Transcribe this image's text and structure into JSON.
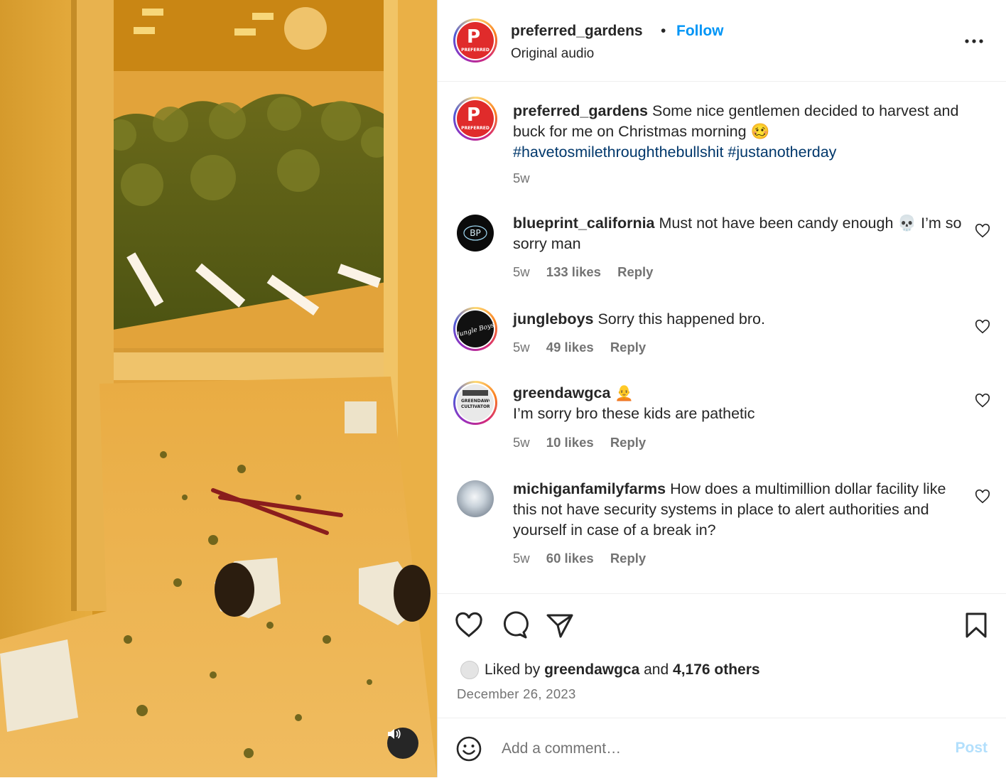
{
  "post": {
    "username": "preferred_gardens",
    "dot": "•",
    "follow_label": "Follow",
    "audio": "Original audio",
    "avatar_text": "PREFERRED"
  },
  "caption": {
    "username": "preferred_gardens",
    "text": "Some nice gentlemen decided to harvest and buck for me on Christmas morning 🥴",
    "hashtags": [
      "#havetosmilethroughthebullshit",
      "#justanotherday"
    ],
    "time": "5w"
  },
  "comments": [
    {
      "username": "blueprint_california",
      "text": "Must not have been candy enough 💀 I’m so sorry man",
      "time": "5w",
      "likes": "133 likes",
      "reply": "Reply",
      "avatar_text": "BP"
    },
    {
      "username": "jungleboys",
      "text": "Sorry this happened bro.",
      "time": "5w",
      "likes": "49 likes",
      "reply": "Reply",
      "avatar_text": "Jungle Boys"
    },
    {
      "username": "greendawgca",
      "text": "🧑‍🦲",
      "text2": "I’m sorry bro these kids are pathetic",
      "time": "5w",
      "likes": "10 likes",
      "reply": "Reply",
      "avatar_text": "GREENDAWG CULTIVATORS"
    },
    {
      "username": "michiganfamilyfarms",
      "text": "How does a multimillion dollar facility like this not have security systems in place to alert authorities and yourself in case of a break in?",
      "time": "5w",
      "likes": "60 likes",
      "reply": "Reply"
    }
  ],
  "likes": {
    "prefix": "Liked by",
    "user": "greendawgca",
    "conj": "and",
    "others": "4,176 others"
  },
  "date": "December 26, 2023",
  "add_comment": {
    "placeholder": "Add a comment…",
    "post_label": "Post"
  },
  "icons": {
    "more": "more-options-icon",
    "like": "heart-icon",
    "comment": "comment-icon",
    "share": "share-icon",
    "save": "bookmark-icon",
    "emoji": "emoji-icon",
    "mute": "speaker-icon"
  },
  "colors": {
    "link": "#0095f6",
    "hashtag": "#00376b",
    "muted": "#737373",
    "post_disabled": "#b2dffc"
  }
}
